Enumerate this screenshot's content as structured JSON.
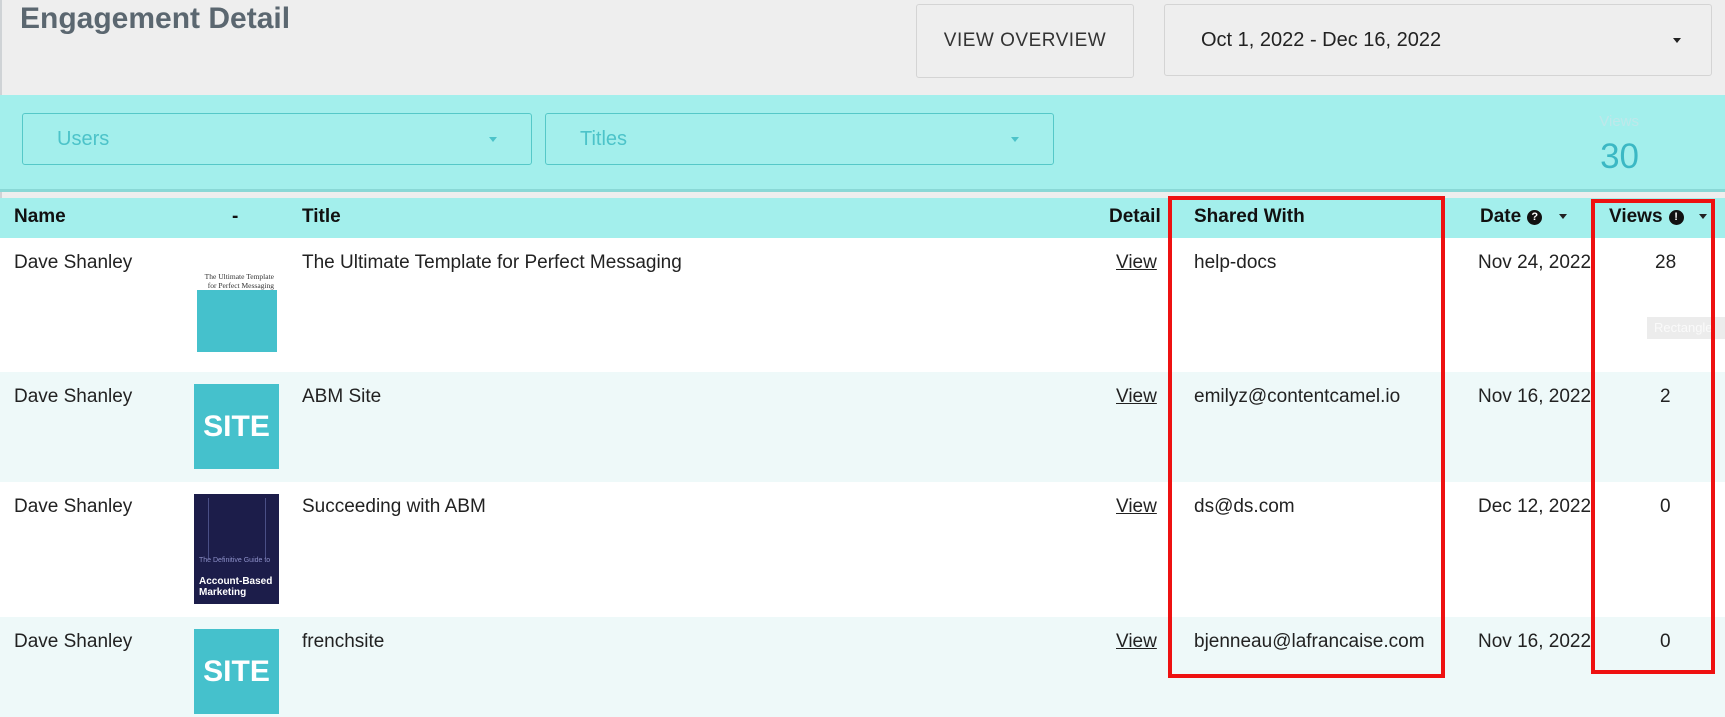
{
  "page_title": "Engagement Detail",
  "header": {
    "view_overview_label": "VIEW OVERVIEW",
    "date_range": "Oct 1, 2022 - Dec 16, 2022"
  },
  "filters": {
    "users_placeholder": "Users",
    "titles_placeholder": "Titles",
    "views_label": "Views",
    "views_total": "30"
  },
  "table": {
    "columns": {
      "name": "Name",
      "thumb": "-",
      "title": "Title",
      "detail": "Detail",
      "shared_with": "Shared With",
      "date": "Date",
      "views": "Views"
    },
    "date_help_icon": "?",
    "views_info_icon": "!",
    "rows": [
      {
        "name": "Dave Shanley",
        "thumb_type": "document",
        "thumb_text": "The Ultimate Template for Perfect Messaging",
        "title": "The Ultimate Template for Perfect Messaging",
        "detail": "View",
        "shared_with": "help-docs",
        "date": "Nov 24, 2022",
        "views": "28"
      },
      {
        "name": "Dave Shanley",
        "thumb_type": "site",
        "thumb_text": "SITE",
        "title": "ABM Site",
        "detail": "View",
        "shared_with": "emilyz@contentcamel.io",
        "date": "Nov 16, 2022",
        "views": "2"
      },
      {
        "name": "Dave Shanley",
        "thumb_type": "ebook",
        "thumb_text_small": "The Definitive Guide to",
        "thumb_text_big": "Account-Based Marketing",
        "title": "Succeeding with ABM",
        "detail": "View",
        "shared_with": "ds@ds.com",
        "date": "Dec 12, 2022",
        "views": "0"
      },
      {
        "name": "Dave Shanley",
        "thumb_type": "site",
        "thumb_text": "SITE",
        "title": "frenchsite",
        "detail": "View",
        "shared_with": "bjenneau@lafrancaise.com",
        "date": "Nov 16, 2022",
        "views": "0"
      }
    ]
  },
  "tooltip": "Rectangle",
  "colors": {
    "filter_bar": "#a3efec",
    "accent": "#45c1cc",
    "highlight": "#ee1111"
  }
}
